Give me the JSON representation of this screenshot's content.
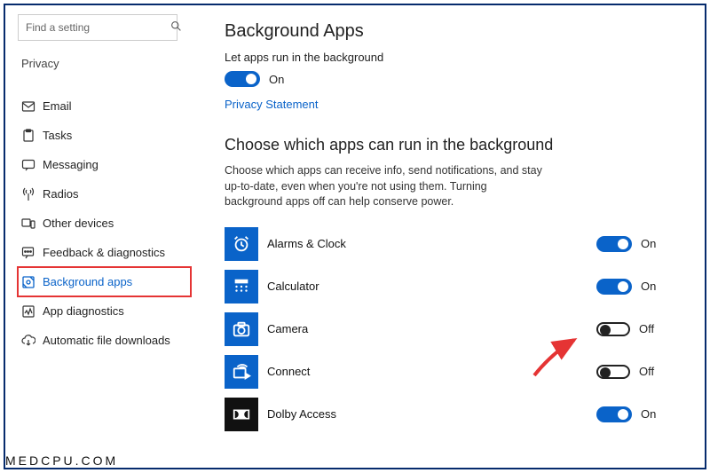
{
  "search": {
    "placeholder": "Find a setting"
  },
  "sidebar": {
    "section": "Privacy",
    "items": [
      {
        "label": "",
        "icon": "none"
      },
      {
        "label": "Email",
        "icon": "email"
      },
      {
        "label": "Tasks",
        "icon": "tasks"
      },
      {
        "label": "Messaging",
        "icon": "messaging"
      },
      {
        "label": "Radios",
        "icon": "radios"
      },
      {
        "label": "Other devices",
        "icon": "devices"
      },
      {
        "label": "Feedback & diagnostics",
        "icon": "feedback"
      },
      {
        "label": "Background apps",
        "icon": "background",
        "selected": true,
        "highlighted": true
      },
      {
        "label": "App diagnostics",
        "icon": "diagnostics"
      },
      {
        "label": "Automatic file downloads",
        "icon": "cloud"
      }
    ]
  },
  "main": {
    "title": "Background Apps",
    "master_subheading": "Let apps run in the background",
    "master_toggle": {
      "state": "on",
      "label": "On"
    },
    "privacy_link": "Privacy Statement",
    "choose_heading": "Choose which apps can run in the background",
    "choose_desc": "Choose which apps can receive info, send notifications, and stay up-to-date, even when you're not using them. Turning background apps off can help conserve power.",
    "apps": [
      {
        "name": "Alarms & Clock",
        "toggle": {
          "state": "on",
          "label": "On"
        },
        "icon": "alarm"
      },
      {
        "name": "Calculator",
        "toggle": {
          "state": "on",
          "label": "On"
        },
        "icon": "calculator"
      },
      {
        "name": "Camera",
        "toggle": {
          "state": "off",
          "label": "Off"
        },
        "icon": "camera"
      },
      {
        "name": "Connect",
        "toggle": {
          "state": "off",
          "label": "Off"
        },
        "icon": "connect"
      },
      {
        "name": "Dolby Access",
        "toggle": {
          "state": "on",
          "label": "On"
        },
        "icon": "dolby"
      }
    ]
  },
  "watermark": "MEDCPU.COM"
}
